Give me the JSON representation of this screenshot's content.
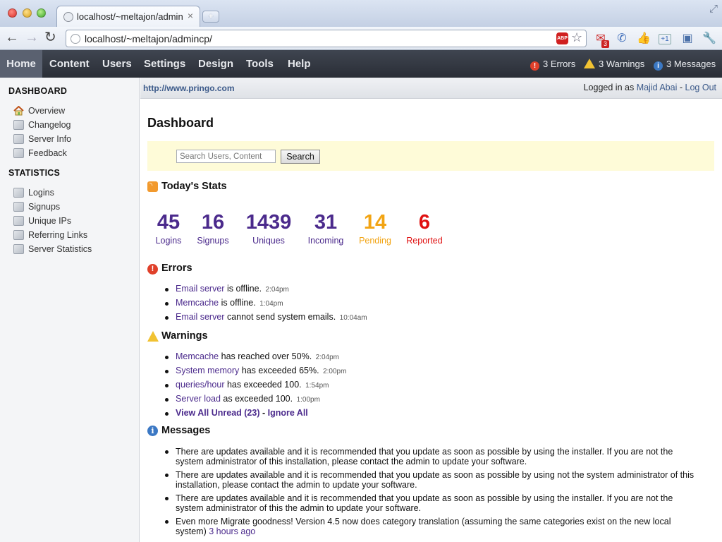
{
  "browser": {
    "tab_title": "localhost/~meltajon/adminc",
    "tab_close": "×",
    "new_tab": "+",
    "url": "localhost/~meltajon/admincp/",
    "abp": "ABP",
    "gmail_badge": "3",
    "plus_label": "+1"
  },
  "nav": {
    "items": [
      {
        "label": "Home"
      },
      {
        "label": "Content"
      },
      {
        "label": "Users"
      },
      {
        "label": "Settings"
      },
      {
        "label": "Design"
      },
      {
        "label": "Tools"
      },
      {
        "label": "Help"
      }
    ],
    "errors": "3 Errors",
    "warnings": "3 Warnings",
    "messages": "3 Messages"
  },
  "sidebar": {
    "heading_dashboard": "DASHBOARD",
    "dashboard_items": [
      {
        "label": "Overview",
        "icon": "house-icon"
      },
      {
        "label": "Changelog",
        "icon": "box-icon"
      },
      {
        "label": "Server Info",
        "icon": "box-icon"
      },
      {
        "label": "Feedback",
        "icon": "box-icon"
      }
    ],
    "heading_statistics": "STATISTICS",
    "statistics_items": [
      {
        "label": "Logins",
        "icon": "box-icon"
      },
      {
        "label": "Signups",
        "icon": "box-icon"
      },
      {
        "label": "Unique IPs",
        "icon": "box-icon"
      },
      {
        "label": "Referring Links",
        "icon": "box-icon"
      },
      {
        "label": "Server Statistics",
        "icon": "box-icon"
      }
    ]
  },
  "header": {
    "site_url": "http://www.pringo.com",
    "logged_in_prefix": "Logged in as",
    "user_name": "Majid Abai",
    "separator": "-",
    "logout": "Log Out"
  },
  "main": {
    "title": "Dashboard",
    "search_placeholder": "Search Users, Content",
    "search_button": "Search",
    "stats_title": "Today's Stats",
    "stats": [
      {
        "value": "45",
        "label": "Logins",
        "color": "#4b2a8c"
      },
      {
        "value": "16",
        "label": "Signups",
        "color": "#4b2a8c"
      },
      {
        "value": "1439",
        "label": "Uniques",
        "color": "#4b2a8c"
      },
      {
        "value": "31",
        "label": "Incoming",
        "color": "#4b2a8c"
      },
      {
        "value": "14",
        "label": "Pending",
        "color": "#f2a413"
      },
      {
        "value": "6",
        "label": "Reported",
        "color": "#e01010"
      }
    ],
    "errors_title": "Errors",
    "errors": [
      {
        "link": "Email server",
        "text": " is offline.",
        "time": "2:04pm"
      },
      {
        "link": "Memcache",
        "text": " is offline.",
        "time": "1:04pm"
      },
      {
        "link": "Email server",
        "text": " cannot send system emails.",
        "time": "10:04am"
      }
    ],
    "warnings_title": "Warnings",
    "warnings": [
      {
        "link": "Memcache",
        "text": " has reached over 50%.",
        "time": "2:04pm"
      },
      {
        "link": "System memory",
        "text": " has exceeded 65%.",
        "time": "2:00pm"
      },
      {
        "link": "queries/hour",
        "text": " has exceeded 100.",
        "time": "1:54pm"
      },
      {
        "link": "Server load",
        "text": " as exceeded 100.",
        "time": "1:00pm"
      }
    ],
    "view_all": "View All Unread (23)",
    "view_sep": " - ",
    "ignore_all": "Ignore All",
    "messages_title": "Messages",
    "messages": [
      {
        "text": "There are updates available and it is recommended that you update as soon as possible by using the installer. If you are not the system administrator of this installation, please contact the admin to update your software."
      },
      {
        "text": "There are updates available and it is recommended that you update as soon as possible by using not the system administrator of this installation, please contact the admin to update your software."
      },
      {
        "text": "There are updates available and it is recommended that you update as soon as possible by using the installer. If you are not the system administrator of this the admin to update your software."
      },
      {
        "text": "Even more Migrate goodness! Version 4.5 now does category translation (assuming the same categories exist on the new local system) ",
        "link": "3 hours ago"
      }
    ]
  }
}
